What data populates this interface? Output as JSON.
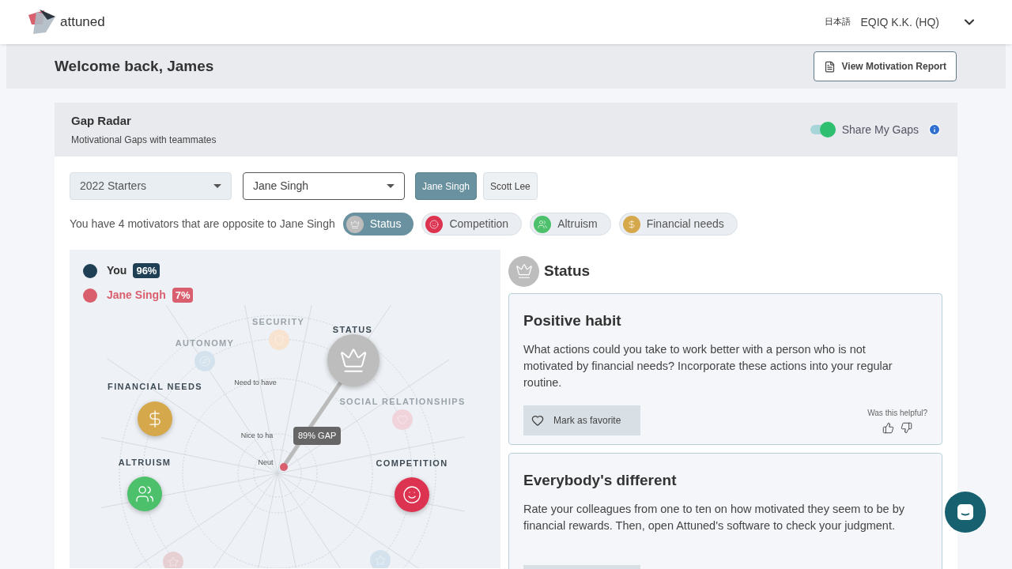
{
  "header": {
    "brand": "attuned",
    "language": "日本語",
    "company": "EQIQ K.K. (HQ)"
  },
  "welcome": {
    "title": "Welcome back, James",
    "report_button": "View Motivation Report"
  },
  "gap_radar": {
    "title": "Gap Radar",
    "subtitle": "Motivational Gaps with teammates",
    "share_toggle": {
      "label": "Share My Gaps",
      "on": true
    },
    "filters": [
      {
        "value": "2022 Starters",
        "kind": "filled"
      },
      {
        "value": "Jane Singh",
        "kind": "outlined"
      }
    ],
    "people": [
      {
        "label": "Jane Singh",
        "selected": true
      },
      {
        "label": "Scott Lee",
        "selected": false
      }
    ],
    "summary": "You have 4 motivators that are opposite to Jane Singh",
    "motivators": [
      {
        "label": "Status",
        "kind": "status",
        "color": "#bdbdbd",
        "selected": true
      },
      {
        "label": "Competition",
        "kind": "competition",
        "color": "#dc3450",
        "selected": false
      },
      {
        "label": "Altruism",
        "kind": "altruism",
        "color": "#4cc06a",
        "selected": false
      },
      {
        "label": "Financial needs",
        "kind": "financial",
        "color": "#d4a84b",
        "selected": false
      }
    ],
    "legend": [
      {
        "name": "You",
        "value": "96%",
        "color": "#1f3f55"
      },
      {
        "name": "Jane Singh",
        "value": "7%",
        "color": "#d95f6e"
      }
    ],
    "rings": [
      "Need to have",
      "Nice to ha",
      "Neut"
    ],
    "gap_label": "89% GAP",
    "nodes": [
      {
        "label": "STATUS",
        "kind": "status",
        "color": "#bdbdbd",
        "faded": false
      },
      {
        "label": "SECURITY",
        "kind": "security",
        "color": "#f7e3cf",
        "faded": true
      },
      {
        "label": "AUTONOMY",
        "kind": "autonomy",
        "color": "#d3e2ec",
        "faded": true
      },
      {
        "label": "FINANCIAL NEEDS",
        "kind": "financial",
        "color": "#d4a84b",
        "faded": false
      },
      {
        "label": "ALTRUISM",
        "kind": "altruism",
        "color": "#4cc06a",
        "faded": false
      },
      {
        "label": "COMPETITION",
        "kind": "competition",
        "color": "#dc3450",
        "faded": false
      },
      {
        "label": "SOCIAL RELATIONSHIPS",
        "kind": "social",
        "color": "#f1d3dc",
        "faded": true
      },
      {
        "kind": "bottom_left",
        "color": "#e6d0d4",
        "faded": true
      },
      {
        "kind": "bottom_right",
        "color": "#d3e2ec",
        "faded": true
      }
    ],
    "detail": {
      "title": "Status",
      "kind": "status",
      "color": "#bdbdbd",
      "cards": [
        {
          "title": "Positive habit",
          "body": "What actions could you take to work better with a person who is not motivated by financial needs? Incorporate these actions into your regular routine.",
          "favorite": "Mark as favorite",
          "helpful": "Was this helpful?"
        },
        {
          "title": "Everybody's different",
          "body": "Rate your colleagues from one to ten on how motivated they seem to be by financial rewards. Then, open Attuned's software to check your judgment."
        }
      ]
    }
  }
}
